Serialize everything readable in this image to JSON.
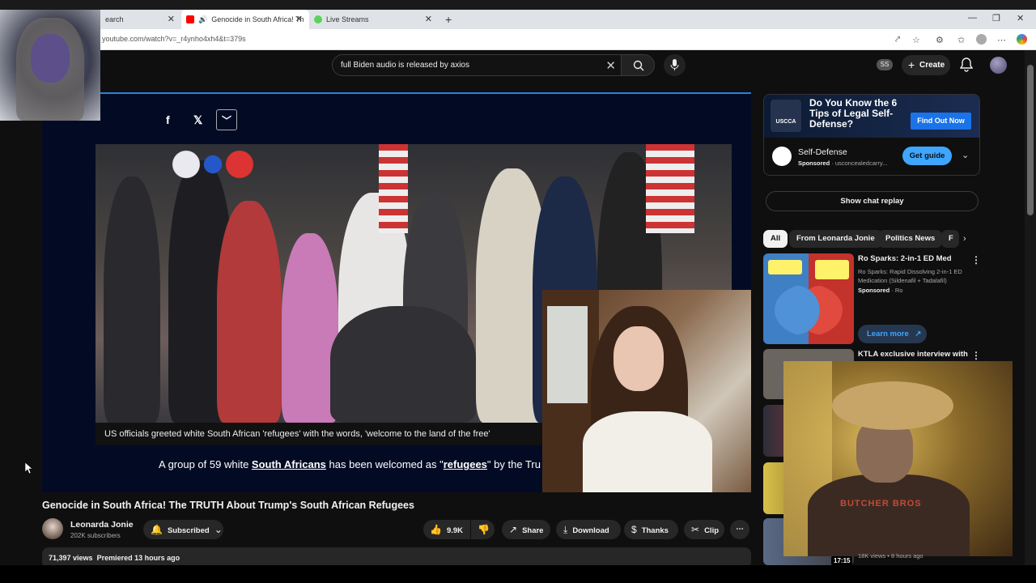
{
  "browser": {
    "tabs": [
      {
        "label": "earch",
        "active": false
      },
      {
        "label": "Genocide in South Africa! Th",
        "active": true
      },
      {
        "label": "Live Streams",
        "active": false
      }
    ],
    "url": "youtube.com/watch?v=_r4ynho4xh4&t=379s"
  },
  "header": {
    "search_value": "full Biden audio is released by axios",
    "ss_badge": "SS",
    "create_label": "Create"
  },
  "video": {
    "caption": "US officials greeted white South African 'refugees' with the words, 'welcome to the land of the free'",
    "subline_prefix": "A group of 59 white ",
    "subline_link1": "South Africans",
    "subline_mid": " has been welcomed as \"",
    "subline_link2": "refugees",
    "subline_suffix": "\" by the Tru",
    "title": "Genocide in South Africa! The TRUTH About Trump's South African Refugees",
    "channel": "Leonarda Jonie",
    "subscribers": "202K subscribers",
    "subscribed_label": "Subscribed",
    "likes": "9.9K",
    "share_label": "Share",
    "download_label": "Download",
    "thanks_label": "Thanks",
    "clip_label": "Clip",
    "views": "71,397 views",
    "premiered": "Premiered 13 hours ago"
  },
  "ad": {
    "headline": "Do You Know the 6 Tips of Legal Self-Defense?",
    "logo_text": "USCCA",
    "cta": "Find Out Now",
    "name": "Self-Defense",
    "sponsored": "Sponsored",
    "advertiser": "usconcealedcarry...",
    "guide_label": "Get guide"
  },
  "sidebar": {
    "chat_replay": "Show chat replay",
    "chips": [
      "All",
      "From Leonarda Jonie",
      "Politics News",
      "F"
    ],
    "items": [
      {
        "title": "Ro Sparks: 2-in-1 ED Med",
        "desc": "Ro Sparks: Rapid Dissolving 2-in-1 ED Medication (Sildenafil + Tadalafil)",
        "sponsored": "Sponsored",
        "by": "Ro",
        "learn_more": "Learn more"
      },
      {
        "title": "KTLA exclusive interview with"
      },
      {
        "meta": "18K views • 8 hours ago",
        "duration": "17:15"
      }
    ],
    "webcam_shirt_text": "BUTCHER BROS"
  },
  "colors": {
    "bg": "#0f0f0f",
    "accent_blue": "#3ea6ff",
    "chip_bg": "#272727"
  }
}
